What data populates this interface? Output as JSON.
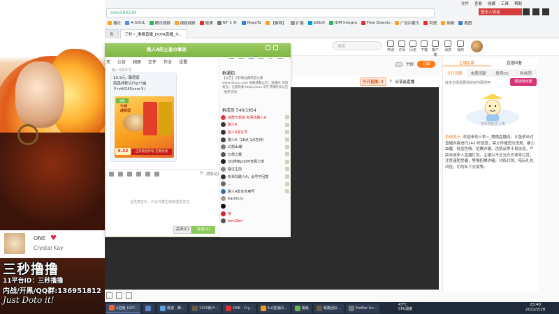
{
  "browser": {
    "address": "com/584239",
    "top_menu": [
      "文件",
      "查看",
      "收藏",
      "工具",
      "帮助"
    ],
    "alert_button": "暂无人说话",
    "bookmarks": [
      {
        "label": "报社"
      },
      {
        "label": "A-SOUL"
      },
      {
        "label": "腾讯视频"
      },
      {
        "label": "搜狐视频"
      },
      {
        "label": "微博"
      },
      {
        "label": "NT × 8-"
      },
      {
        "label": "NyaaTo"
      },
      {
        "label": "【推荐】"
      },
      {
        "label": "扩展"
      },
      {
        "label": "bilibili"
      },
      {
        "label": "IDM Integra"
      },
      {
        "label": "Free Downlo"
      },
      {
        "label": "广告拦截大"
      },
      {
        "label": "阿里"
      },
      {
        "label": "购物"
      },
      {
        "label": "截图"
      }
    ],
    "tabs": [
      {
        "label": "色",
        "active": false
      },
      {
        "label": "三秒~_撸撸直播_DOTA直播_斗...",
        "active": true
      }
    ]
  },
  "site": {
    "search_placeholder": "搜索",
    "header_icons": [
      "开通",
      "订阅",
      "历史",
      "下载",
      "客户端",
      "消息",
      "我的"
    ],
    "share_label": "举报",
    "subscribe_label": "订阅",
    "stream_badge": "可开直播: 2",
    "stream_share": "分享此直播"
  },
  "right_panel": {
    "tabs_top": [
      "主播招募",
      "直播回看"
    ],
    "tabs_second": [
      "今日贡献",
      "本周贡献",
      "贵宾(0)",
      "粉丝团"
    ],
    "note": "成本也很需要组织好你那样吧",
    "badge": "超级粉丝团",
    "empty_text": "还未有粉丝上榜",
    "notice_label": "系统提示:",
    "notice_text": "欢迎来到三秒~_撸撸直播间。斗鱼依法对直播内容进行24小时巡查，禁止传播违法违规、暴力血腥、低俗色情、招嫖诈骗、违禁品等不良信息，严禁未成年人直播打赏。主播以不正当方式诱导打赏，注意谨防受骗，警惕招嫖诈骗，代练代驾、陪玩礼包风险，切勿私下交易等。"
  },
  "chat": {
    "title": "路人A的土星の事处",
    "tabs": [
      "天",
      "公告",
      "相册",
      "文件",
      "作业",
      "设置"
    ],
    "sub_label": "路人A发车号",
    "message": {
      "line1": "10.9元 ·薄荷家",
      "line2": "南昌拌粉225g*3盒",
      "line3": "￥rvItf245cxrx￥/",
      "product_tag": "爆款",
      "product_label": "干拌\n咸鲜型",
      "price": "5.32",
      "promo": "正宗南昌拌粉 无需蒸煮"
    },
    "input_hint": "全员禁言中，只允许群主和管理员发言",
    "input_right": [
      "消息记录"
    ],
    "close_label": "关闭(C)",
    "send_label": "发送(S)",
    "notice_title": "群通知",
    "notice_body": "【公告】三秒粉丝群欢迎大家 www.douyu.com 进群请看公告，直播间 文明发言，注意形象 https://xxx 5月·开播时间公告 · 抽奖活动",
    "member_count_label": "群成员 540/1954",
    "members": [
      {
        "name": "进群不想单·有事找路人A",
        "color": "red"
      },
      {
        "name": "路人A",
        "color": "red"
      },
      {
        "name": "路人A发车号",
        "color": "red"
      },
      {
        "name": "路人A（18点-1点在线）",
        "color": ""
      },
      {
        "name": "幻想ds暖",
        "color": ""
      },
      {
        "name": "幻想之翼",
        "color": ""
      },
      {
        "name": "QQ搜索pdd可查看订单",
        "color": ""
      },
      {
        "name": "路过生煎",
        "color": ""
      },
      {
        "name": "有事找路人A，此号不回复",
        "color": ""
      },
      {
        "name": "...",
        "color": ""
      },
      {
        "name": "路人A发车专用号",
        "color": ""
      },
      {
        "name": "Kackinzy",
        "color": ""
      },
      {
        "name": "·",
        "color": ""
      },
      {
        "name": "夜",
        "color": "red"
      },
      {
        "name": "beru5ert",
        "color": "red"
      }
    ]
  },
  "overlay": {
    "music_title": "ONE",
    "music_artist": "Crystal Kay",
    "big_title": "三秒撸撸",
    "platform_id": "11平台ID：三秒撸撸",
    "qq_line": "内战/开黑/QQ群:136951812",
    "script_tag": "Just Doto it!"
  },
  "taskbar": {
    "items": [
      {
        "label": "A直播_DOT...",
        "color": "#e8663d"
      },
      {
        "label": "",
        "color": "#5f83c9"
      },
      {
        "label": "路遇 - 腾...",
        "color": "#5aa0e6"
      },
      {
        "label": "1155被卢...",
        "color": "#6c5a45"
      },
      {
        "label": "ONE - Cry...",
        "color": "#e43030"
      },
      {
        "label": "A-A直播间...",
        "color": "#f29b23"
      },
      {
        "label": "路路",
        "color": "#65b44c"
      },
      {
        "label": "路路团队...",
        "color": "#6c5a45"
      },
      {
        "label": "Profiler Un...",
        "color": "#777777"
      }
    ],
    "weather": "43°C\nCPU温度",
    "time": "23:40",
    "date": "2022/2/28"
  },
  "colors": {
    "accent": "#ff7a1a",
    "chat_header": "#7eb742",
    "danger": "#d8232a"
  }
}
